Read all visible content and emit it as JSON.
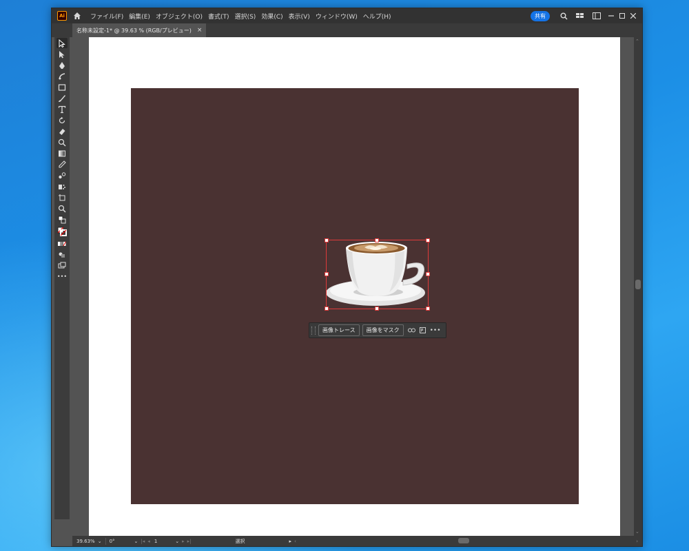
{
  "app": {
    "logo": "Ai",
    "menu": [
      "ファイル(F)",
      "編集(E)",
      "オブジェクト(O)",
      "書式(T)",
      "選択(S)",
      "効果(C)",
      "表示(V)",
      "ウィンドウ(W)",
      "ヘルプ(H)"
    ],
    "share_label": "共有",
    "brand_color": "#ff9a00",
    "accent_color": "#1473e6"
  },
  "tab": {
    "title": "名称未設定-1* @ 39.63 % (RGB/プレビュー)",
    "close": "×"
  },
  "context_bar": {
    "trace_label": "画像トレース",
    "mask_label": "画像をマスク",
    "more": "•••"
  },
  "toolbar": {
    "more": "•••"
  },
  "status": {
    "zoom": "39.63%",
    "rotation": "0°",
    "artboard": "1",
    "tool": "選択"
  },
  "canvas": {
    "artboard_color": "#ffffff",
    "background_color": "#4a3232",
    "selection_color": "#e03b3b"
  }
}
